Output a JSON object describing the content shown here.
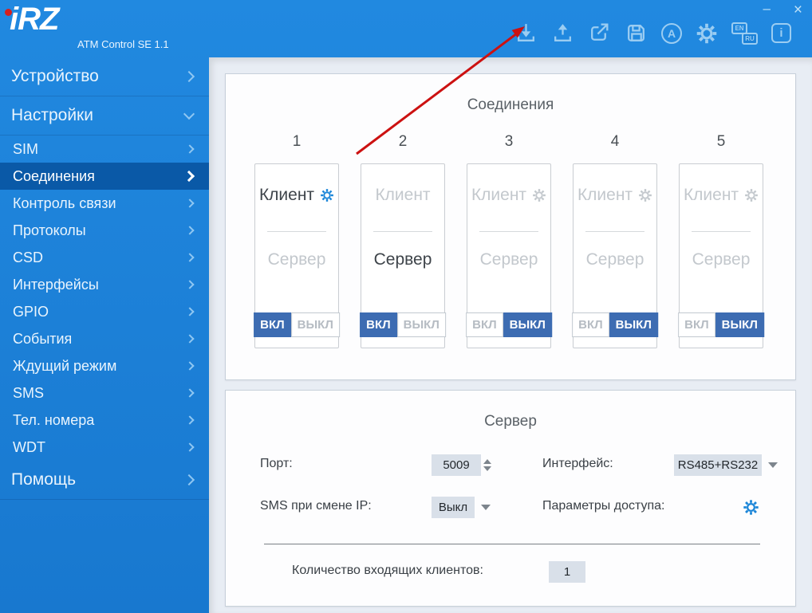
{
  "window": {
    "minimize": "–",
    "close": "×"
  },
  "header": {
    "logo_text": "iRZ",
    "app_title": "ATM Control SE 1.1",
    "toolbar": {
      "icons": [
        "download-icon",
        "upload-icon",
        "export-icon",
        "save-icon",
        "auto-answer-icon",
        "settings-gear-icon",
        "language-icon",
        "info-icon"
      ],
      "lang_back": "EN",
      "lang_front": "RU",
      "auto_letter": "A",
      "info_letter": "i"
    }
  },
  "sidebar": {
    "items": [
      {
        "label": "Устройство",
        "type": "top",
        "chevron": "right"
      },
      {
        "label": "Настройки",
        "type": "top",
        "chevron": "down",
        "expanded": true
      },
      {
        "label": "SIM",
        "type": "sub"
      },
      {
        "label": "Соединения",
        "type": "sub",
        "selected": true
      },
      {
        "label": "Контроль связи",
        "type": "sub"
      },
      {
        "label": "Протоколы",
        "type": "sub"
      },
      {
        "label": "CSD",
        "type": "sub"
      },
      {
        "label": "Интерфейсы",
        "type": "sub"
      },
      {
        "label": "GPIO",
        "type": "sub"
      },
      {
        "label": "События",
        "type": "sub"
      },
      {
        "label": "Ждущий режим",
        "type": "sub"
      },
      {
        "label": "SMS",
        "type": "sub"
      },
      {
        "label": "Тел. номера",
        "type": "sub"
      },
      {
        "label": "WDT",
        "type": "sub"
      },
      {
        "label": "Помощь",
        "type": "top",
        "chevron": "right"
      }
    ]
  },
  "connections": {
    "title": "Соединения",
    "client_label": "Клиент",
    "server_label": "Сервер",
    "on_label": "ВКЛ",
    "off_label": "ВЫКЛ",
    "columns": [
      {
        "number": "1",
        "active_mode": "client",
        "gear": "blue",
        "toggle": "on"
      },
      {
        "number": "2",
        "active_mode": "server",
        "gear": "none",
        "toggle": "on"
      },
      {
        "number": "3",
        "active_mode": "none",
        "gear": "gray",
        "toggle": "off"
      },
      {
        "number": "4",
        "active_mode": "none",
        "gear": "gray",
        "toggle": "off"
      },
      {
        "number": "5",
        "active_mode": "none",
        "gear": "gray",
        "toggle": "off"
      }
    ]
  },
  "server": {
    "title": "Сервер",
    "port_label": "Порт:",
    "port_value": "5009",
    "interface_label": "Интерфейс:",
    "interface_value": "RS485+RS232",
    "sms_ip_label": "SMS при смене IP:",
    "sms_ip_value": "Выкл",
    "access_label": "Параметры доступа:",
    "incoming_label": "Количество входящих клиентов:",
    "incoming_value": "1"
  },
  "colors": {
    "header_blue": "#1b81d8",
    "selected_blue": "#0a59a7",
    "toggle_active": "#3d6cb2",
    "icon_blue": "#9bcdf2",
    "gear_blue": "#1c86d8",
    "arrow_red": "#cc1111"
  }
}
